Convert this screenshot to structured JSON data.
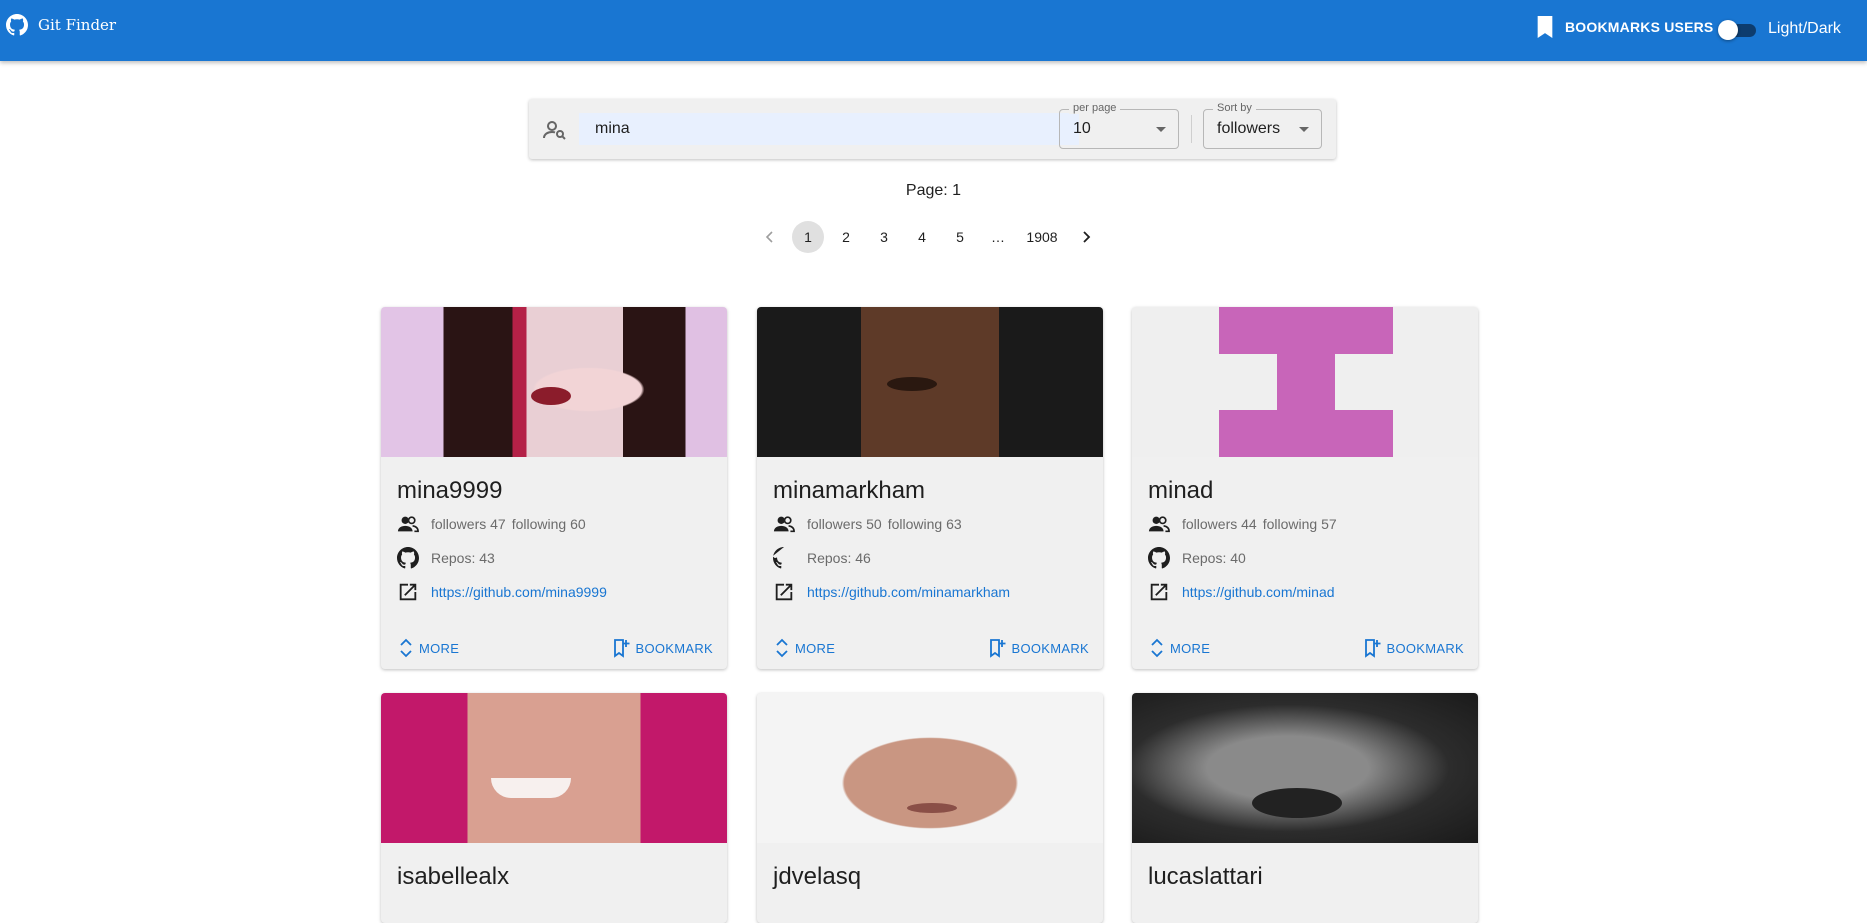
{
  "app": {
    "title": "Git Finder",
    "bookmarks_label": "BOOKMARKS USERS",
    "theme_label": "Light/Dark",
    "colors": {
      "primary": "#1976d2",
      "card_bg": "#f0f0f0"
    }
  },
  "search": {
    "value": "mina",
    "per_page": {
      "label": "per page",
      "value": "10"
    },
    "sort_by": {
      "label": "Sort by",
      "value": "followers"
    }
  },
  "page_label": "Page: 1",
  "pagination": {
    "pages": [
      "1",
      "2",
      "3",
      "4",
      "5",
      "…",
      "1908"
    ],
    "active": "1"
  },
  "cards": [
    {
      "login": "mina9999",
      "followers": "followers 47",
      "following": "following 60",
      "repos": "Repos: 43",
      "url": "https://github.com/mina9999",
      "more": "MORE",
      "bookmark": "BOOKMARK"
    },
    {
      "login": "minamarkham",
      "followers": "followers 50",
      "following": "following 63",
      "repos": "Repos: 46",
      "url": "https://github.com/minamarkham",
      "more": "MORE",
      "bookmark": "BOOKMARK"
    },
    {
      "login": "minad",
      "followers": "followers 44",
      "following": "following 57",
      "repos": "Repos: 40",
      "url": "https://github.com/minad",
      "more": "MORE",
      "bookmark": "BOOKMARK"
    },
    {
      "login": "isabellealx"
    },
    {
      "login": "jdvelasq"
    },
    {
      "login": "lucaslattari"
    }
  ]
}
